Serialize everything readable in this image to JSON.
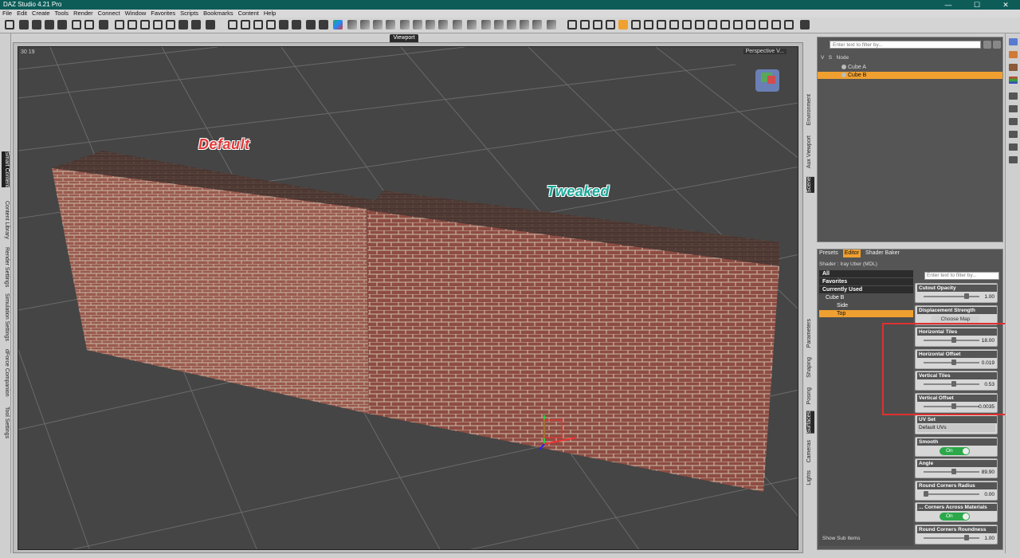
{
  "window": {
    "title": "DAZ Studio 4.21 Pro",
    "controls": [
      "—",
      "☐",
      "✕"
    ]
  },
  "menu": [
    "File",
    "Edit",
    "Create",
    "Tools",
    "Render",
    "Connect",
    "Window",
    "Favorites",
    "Scripts",
    "Bookmarks",
    "Content",
    "Help"
  ],
  "left_tabs": [
    "Smart Content",
    "Content Library",
    "Render Settings",
    "Simulation Settings",
    "dForce Companion",
    "Tool Settings"
  ],
  "viewport": {
    "tab_label": "Viewport",
    "coords": "30 19",
    "camera": "Perspective V...",
    "label_default": "Default",
    "label_tweaked": "Tweaked"
  },
  "right_tabs_top": [
    "Environment",
    "Aux Viewport",
    "Scene"
  ],
  "right_tabs_bottom": [
    "Parameters",
    "Shaping",
    "Posing",
    "Surfaces",
    "Cameras",
    "Lights"
  ],
  "scene": {
    "filter_placeholder": "Enter text to filter by...",
    "col_v": "V",
    "col_s": "S",
    "col_node": "Node",
    "nodes": [
      {
        "name": "Cube A",
        "selected": false
      },
      {
        "name": "Cube B",
        "selected": true
      }
    ]
  },
  "surfaces": {
    "tabs": [
      "Presets",
      "Editor",
      "Shader Baker"
    ],
    "active_tab": "Editor",
    "shader": "Shader : Iray Uber (MDL)",
    "tree_headers": [
      "All",
      "Favorites",
      "Currently Used"
    ],
    "tree_items": [
      {
        "label": "Cube B",
        "level": 0,
        "selected": false
      },
      {
        "label": "Side",
        "level": 1,
        "selected": false
      },
      {
        "label": "Top",
        "level": 1,
        "selected": true
      }
    ],
    "show_sub_items": "Show Sub Items",
    "filter_placeholder": "Enter text to filter by...",
    "params": [
      {
        "name": "Cutout Opacity",
        "kind": "slider",
        "value": "1.00",
        "pos": 0.8
      },
      {
        "name": "Displacement Strength",
        "kind": "button",
        "button": "Choose Map"
      },
      {
        "name": "Horizontal Tiles",
        "kind": "slider",
        "value": "18.00",
        "pos": 0.55
      },
      {
        "name": "Horizontal Offset",
        "kind": "slider",
        "value": "0.019",
        "pos": 0.55
      },
      {
        "name": "Vertical Tiles",
        "kind": "slider",
        "value": "0.53",
        "pos": 0.55
      },
      {
        "name": "Vertical Offset",
        "kind": "slider",
        "value": "0.0035",
        "pos": 0.55
      },
      {
        "name": "UV Set",
        "kind": "select",
        "value": "Default UVs"
      },
      {
        "name": "Smooth",
        "kind": "toggle",
        "value": "On"
      },
      {
        "name": "Angle",
        "kind": "slider",
        "value": "89.90",
        "pos": 0.55
      },
      {
        "name": "Round Corners Radius",
        "kind": "slider",
        "value": "0.00",
        "pos": 0.0
      },
      {
        "name": "... Corners Across Materials",
        "kind": "toggle",
        "value": "On"
      },
      {
        "name": "Round Corners Roundness",
        "kind": "slider",
        "value": "1.00",
        "pos": 0.8
      }
    ]
  }
}
